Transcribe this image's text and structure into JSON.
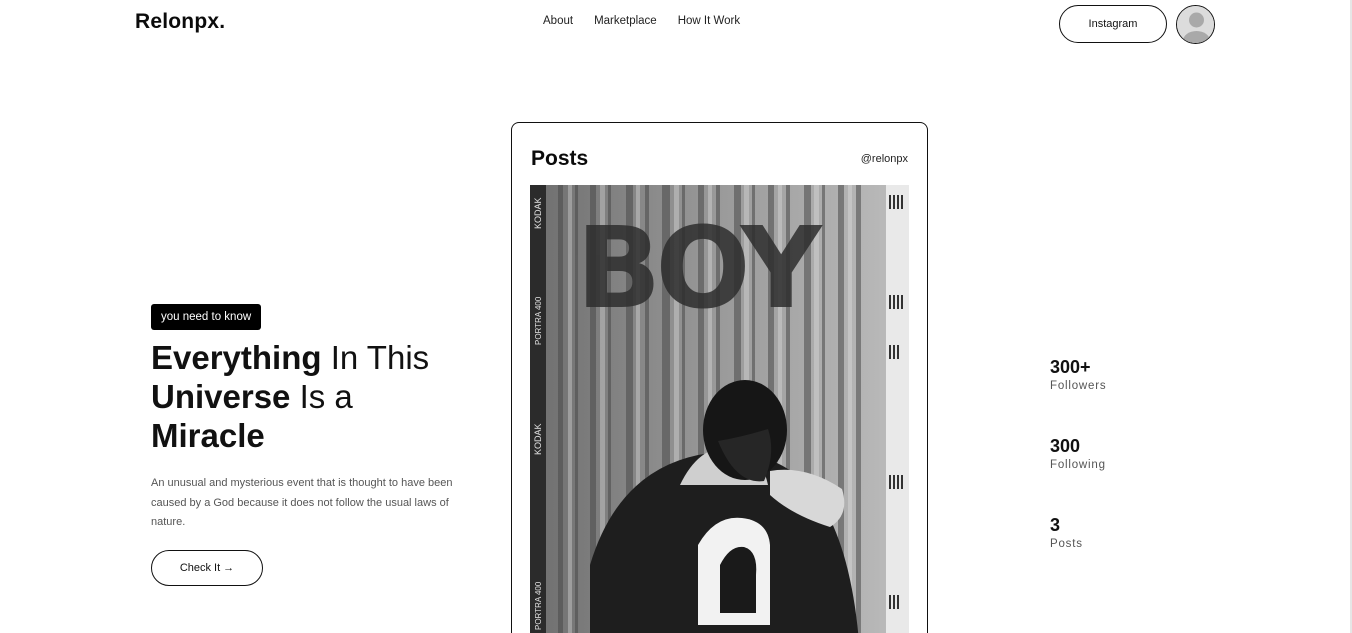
{
  "brand": {
    "logo": "Relonpx."
  },
  "nav": {
    "items": [
      "About",
      "Marketplace",
      "How It Work"
    ]
  },
  "header": {
    "instagram_label": "Instagram"
  },
  "hero": {
    "badge": "you need to know",
    "headline": {
      "w1": "Everything",
      "w2": " In This",
      "w3": "Universe",
      "w4": " Is a",
      "w5": "Miracle"
    },
    "description": "An unusual and mysterious event that is thought to have been caused by a God because it does not follow the usual laws of nature.",
    "cta_label": "Check It",
    "cta_arrow": "→"
  },
  "card": {
    "title": "Posts",
    "handle": "@relonpx",
    "photo": {
      "graffiti": "BOY",
      "film_brand": "KODAK",
      "film_type": "PORTRA 400"
    }
  },
  "stats": [
    {
      "value": "300+",
      "label": "Followers"
    },
    {
      "value": "300",
      "label": "Following"
    },
    {
      "value": "3",
      "label": "Posts"
    }
  ],
  "icons": {
    "avatar": "user-avatar-icon",
    "arrow": "arrow-right-icon"
  },
  "colors": {
    "text": "#111111",
    "muted": "#555555",
    "badge_bg": "#000000",
    "background": "#ffffff"
  }
}
